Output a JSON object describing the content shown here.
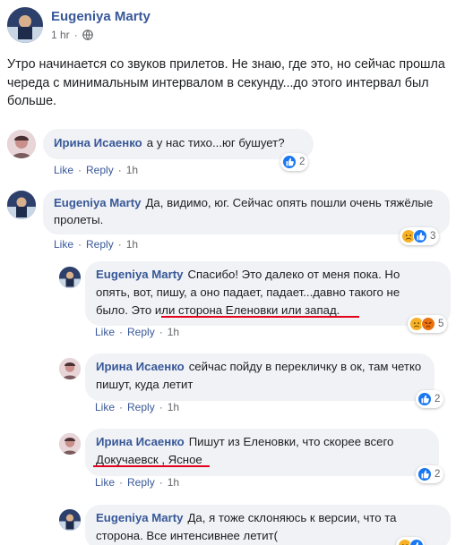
{
  "post": {
    "author": "Eugeniya Marty",
    "time": "1 hr",
    "separator": "·",
    "text": "Утро начинается со звуков прилетов. Не знаю, где это, но сейчас прошла череда с минимальным интервалом в секунду...до этого интервал был больше."
  },
  "actions": {
    "like": "Like",
    "reply": "Reply",
    "sep": "·"
  },
  "comments": [
    {
      "author": "Ирина Исаенко",
      "text": "а у нас тихо...юг бушует?",
      "time": "1h",
      "reactions": [
        "like"
      ],
      "count": "2"
    },
    {
      "author": "Eugeniya Marty",
      "text": "Да, видимо, юг. Сейчас опять пошли очень тяжёлые пролеты.",
      "time": "1h",
      "reactions": [
        "sad",
        "like"
      ],
      "count": "3"
    },
    {
      "author": "Eugeniya Marty",
      "text_line1": "Спасибо! Это далеко от меня пока. Но",
      "text_line2": "опять, вот, пишу, а оно падает, падает...давно такого не",
      "text_line3": "было. Это",
      "text_underlined": "или сторона Еленовки или запад.",
      "time": "1h",
      "reactions": [
        "sad",
        "angry"
      ],
      "count": "5"
    },
    {
      "author": "Ирина Исаенко",
      "text": "сейчас пойду в перекличку в ок, там четко пишут, куда летит",
      "time": "1h",
      "reactions": [
        "like"
      ],
      "count": "2"
    },
    {
      "author": "Ирина Исаенко",
      "text_line1": "Пишут из Еленовки, что скорее всего",
      "text_underlined": "Докучаевск , Ясное",
      "time": "1h",
      "reactions": [
        "like"
      ],
      "count": "2"
    },
    {
      "author": "Eugeniya Marty",
      "text": "Да, я тоже склоняюсь к версии, что та сторона. Все интенсивнее летит(",
      "reactions": [
        "sad",
        "like"
      ]
    }
  ],
  "colors": {
    "link": "#385898",
    "bubble": "#f0f2f5",
    "underline": "#e4001b",
    "like": "#1877f2",
    "sad": "#f7b125",
    "angry": "#e9710f"
  }
}
